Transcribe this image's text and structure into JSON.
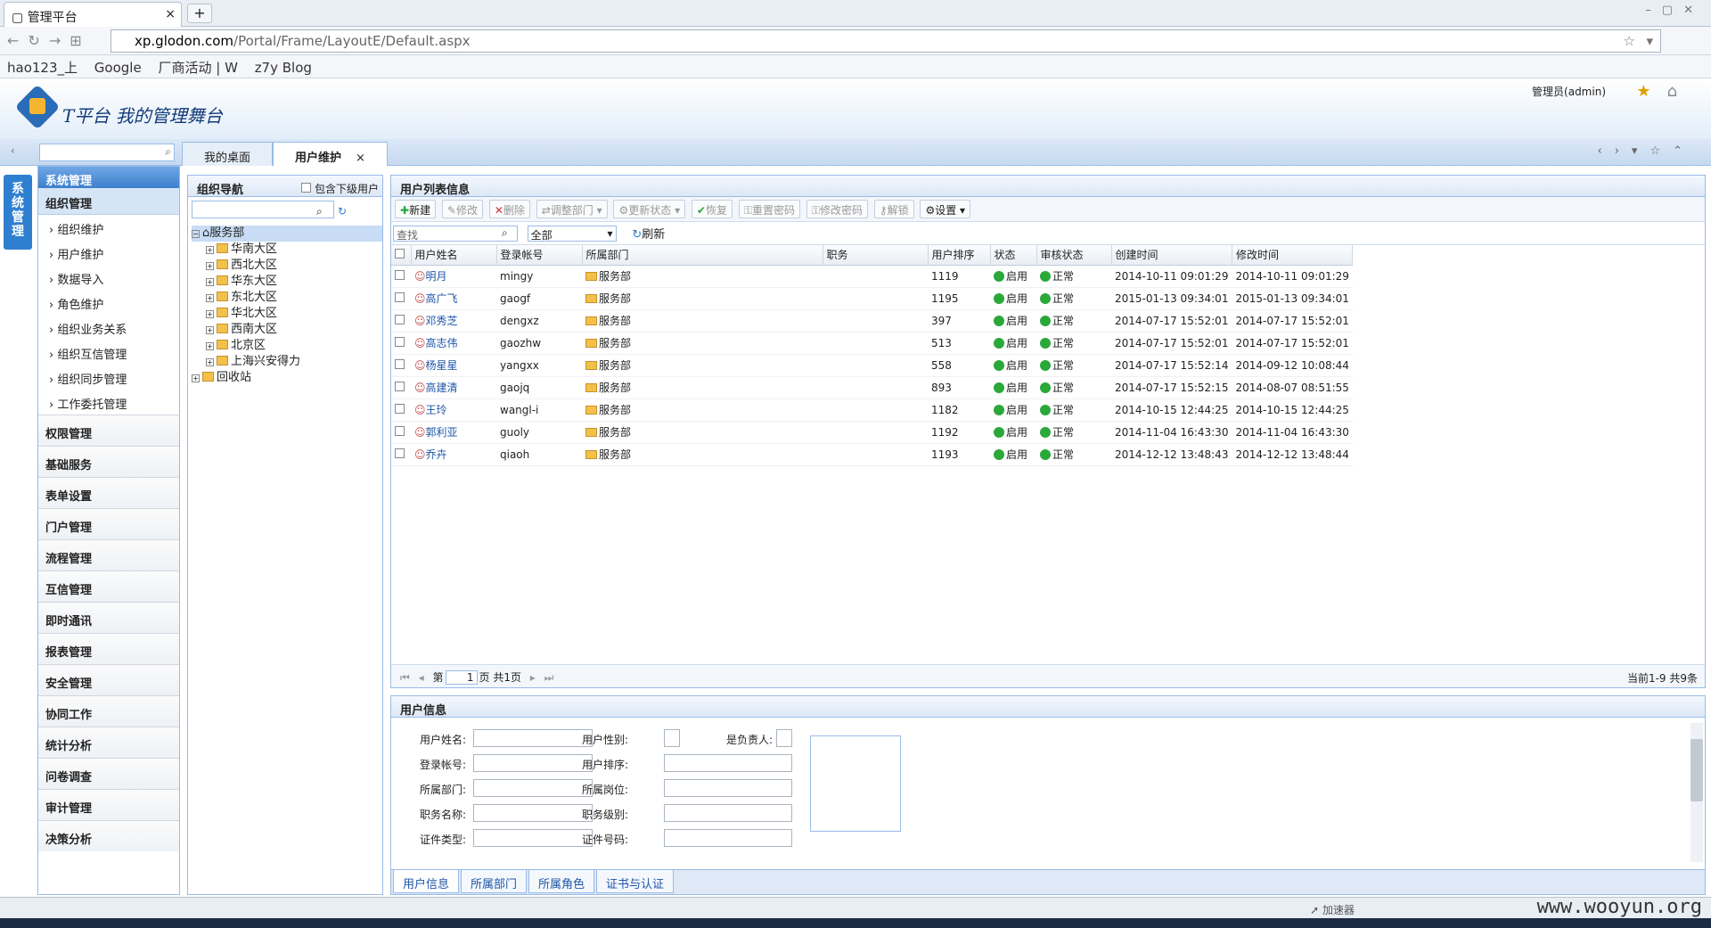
{
  "browser": {
    "tab_title": "管理平台",
    "new_tab": "+",
    "url_domain": "xp.glodon.com",
    "url_path": "/Portal/Frame/LayoutE/Default.aspx",
    "bookmarks": [
      "hao123_上",
      "Google",
      "厂商活动 | W",
      "z7y Blog"
    ]
  },
  "header": {
    "app_title": "T平台 我的管理舞台",
    "admin_label": "管理员(admin)"
  },
  "tabs": [
    {
      "label": "我的桌面"
    },
    {
      "label": "用户维护",
      "close": "×"
    }
  ],
  "sidebar": {
    "vertical_tab": "系统管理",
    "menu_head": "系统管理",
    "active_group": "组织管理",
    "items": [
      "组织维护",
      "用户维护",
      "数据导入",
      "角色维护",
      "组织业务关系",
      "组织互信管理",
      "组织同步管理",
      "工作委托管理"
    ],
    "categories": [
      "权限管理",
      "基础服务",
      "表单设置",
      "门户管理",
      "流程管理",
      "互信管理",
      "即时通讯",
      "报表管理",
      "安全管理",
      "协同工作",
      "统计分析",
      "问卷调查",
      "审计管理",
      "决策分析"
    ]
  },
  "org": {
    "title": "组织导航",
    "include_sub": "包含下级用户",
    "root": "服务部",
    "children": [
      "华南大区",
      "西北大区",
      "华东大区",
      "东北大区",
      "华北大区",
      "西南大区",
      "北京区",
      "上海兴安得力"
    ],
    "recycle": "回收站"
  },
  "list": {
    "title": "用户列表信息",
    "toolbar": [
      "新建",
      "修改",
      "删除",
      "调整部门",
      "更新状态",
      "恢复",
      "重置密码",
      "修改密码",
      "解锁",
      "设置"
    ],
    "find_placeholder": "查找",
    "status_filter": "全部",
    "refresh": "刷新",
    "columns": [
      "用户姓名",
      "登录帐号",
      "所属部门",
      "职务",
      "用户排序",
      "状态",
      "审核状态",
      "创建时间",
      "修改时间"
    ],
    "rows": [
      {
        "name": "明月",
        "account": "mingy",
        "dept": "服务部",
        "order": "1119",
        "status": "启用",
        "audit": "正常",
        "created": "2014-10-11 09:01:29",
        "modified": "2014-10-11 09:01:29"
      },
      {
        "name": "高广飞",
        "account": "gaogf",
        "dept": "服务部",
        "order": "1195",
        "status": "启用",
        "audit": "正常",
        "created": "2015-01-13 09:34:01",
        "modified": "2015-01-13 09:34:01"
      },
      {
        "name": "邓秀芝",
        "account": "dengxz",
        "dept": "服务部",
        "order": "397",
        "status": "启用",
        "audit": "正常",
        "created": "2014-07-17 15:52:01",
        "modified": "2014-07-17 15:52:01"
      },
      {
        "name": "高志伟",
        "account": "gaozhw",
        "dept": "服务部",
        "order": "513",
        "status": "启用",
        "audit": "正常",
        "created": "2014-07-17 15:52:01",
        "modified": "2014-07-17 15:52:01"
      },
      {
        "name": "杨星星",
        "account": "yangxx",
        "dept": "服务部",
        "order": "558",
        "status": "启用",
        "audit": "正常",
        "created": "2014-07-17 15:52:14",
        "modified": "2014-09-12 10:08:44"
      },
      {
        "name": "高建清",
        "account": "gaojq",
        "dept": "服务部",
        "order": "893",
        "status": "启用",
        "audit": "正常",
        "created": "2014-07-17 15:52:15",
        "modified": "2014-08-07 08:51:55"
      },
      {
        "name": "王玲",
        "account": "wangl-i",
        "dept": "服务部",
        "order": "1182",
        "status": "启用",
        "audit": "正常",
        "created": "2014-10-15 12:44:25",
        "modified": "2014-10-15 12:44:25"
      },
      {
        "name": "郭利亚",
        "account": "guoly",
        "dept": "服务部",
        "order": "1192",
        "status": "启用",
        "audit": "正常",
        "created": "2014-11-04 16:43:30",
        "modified": "2014-11-04 16:43:30"
      },
      {
        "name": "乔卉",
        "account": "qiaoh",
        "dept": "服务部",
        "order": "1193",
        "status": "启用",
        "audit": "正常",
        "created": "2014-12-12 13:48:43",
        "modified": "2014-12-12 13:48:44"
      }
    ],
    "pager": {
      "prefix": "第",
      "page": "1",
      "suffix": "页 共1页",
      "summary": "当前1-9 共9条"
    }
  },
  "info": {
    "title": "用户信息",
    "fields": [
      "用户姓名:",
      "登录帐号:",
      "所属部门:",
      "职务名称:",
      "证件类型:"
    ],
    "fields_mid": [
      "用户性别:",
      "用户排序:",
      "所属岗位:",
      "职务级别:",
      "证件号码:"
    ],
    "leader": "是负责人:",
    "tabs": [
      "用户信息",
      "所属部门",
      "所属角色",
      "证书与认证"
    ]
  },
  "status": {
    "accelerator": "加速器",
    "watermark": "www.wooyun.org"
  }
}
